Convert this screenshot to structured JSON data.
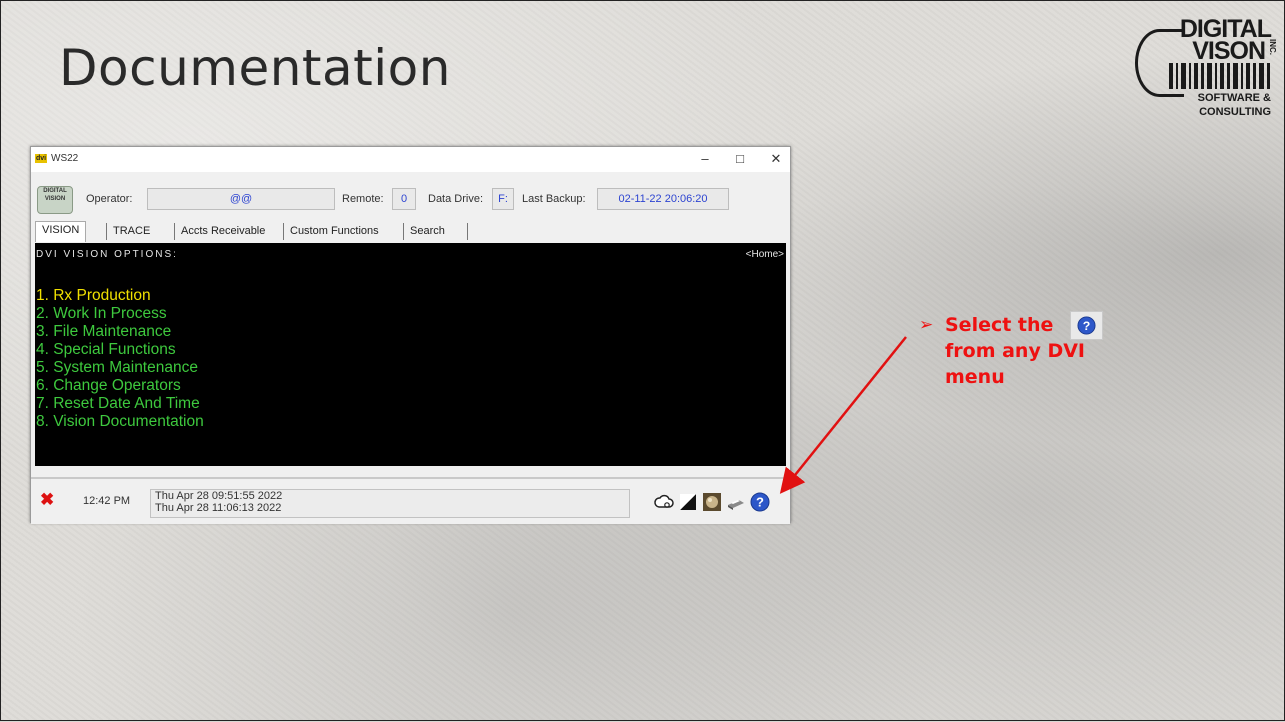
{
  "slide": {
    "title": "Documentation",
    "logo": {
      "line1": "DIGITAL",
      "line2": "VISON",
      "sub1": "SOFTWARE &",
      "sub2": "CONSULTING",
      "inc": "INC."
    }
  },
  "window": {
    "title": "WS22",
    "app_icon_text": "dvi",
    "controls": {
      "minimize": "–",
      "maximize": "□",
      "close": "✕"
    },
    "info": {
      "badge_line1": "DIGITAL",
      "badge_line2": "VISION",
      "operator_label": "Operator:",
      "operator_value": "@@",
      "remote_label": "Remote:",
      "remote_value": "0",
      "data_drive_label": "Data Drive:",
      "data_drive_value": "F:",
      "last_backup_label": "Last Backup:",
      "last_backup_value": "02-11-22  20:06:20"
    },
    "tabs": [
      {
        "label": "VISION",
        "active": true
      },
      {
        "label": "TRACE"
      },
      {
        "label": "Accts Receivable"
      },
      {
        "label": "Custom Functions"
      },
      {
        "label": "Search"
      }
    ],
    "terminal": {
      "header": "DVI  VISION OPTIONS:",
      "home": "<Home>",
      "items": [
        "1. Rx Production",
        "2. Work In Process",
        "3. File Maintenance",
        "4. Special Functions",
        "5. System Maintenance",
        "6. Change Operators",
        "7. Reset Date And Time",
        "8. Vision Documentation"
      ],
      "colors": {
        "selected": "#f0e000",
        "normal": "#3ec93e"
      }
    },
    "status": {
      "time": "12:42 PM",
      "date_line1": "Thu Apr 28 09:51:55 2022",
      "date_line2": "Thu Apr 28 11:06:13 2022",
      "tools": [
        "cloud-icon",
        "contrast-icon",
        "photo-icon",
        "printer-icon",
        "help-icon"
      ]
    }
  },
  "annotation": {
    "line1": "Select the",
    "line2": "from any DVI",
    "line3": "menu",
    "bullet": "➢",
    "color": "#e11111"
  }
}
